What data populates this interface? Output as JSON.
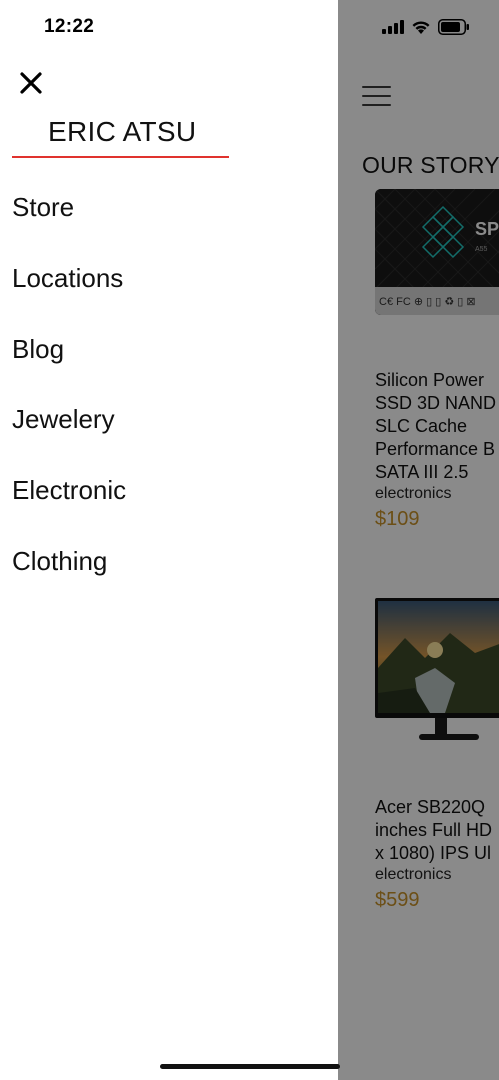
{
  "status_bar": {
    "time": "12:22"
  },
  "drawer": {
    "user_name": "ERIC ATSU",
    "menu_items": [
      {
        "label": "Store"
      },
      {
        "label": "Locations"
      },
      {
        "label": "Blog"
      },
      {
        "label": "Jewelery"
      },
      {
        "label": "Electronic"
      },
      {
        "label": "Clothing"
      }
    ],
    "accent_color": "#e0322e"
  },
  "background": {
    "section_title": "OUR STORY",
    "price_color": "#c8922a",
    "products": [
      {
        "name": "Silicon Power\nSSD 3D NAND\nSLC Cache\nPerformance B\nSATA III 2.5",
        "category": "electronics",
        "price": "$109"
      },
      {
        "name": "Acer SB220Q\ninches Full HD\nx 1080) IPS Ul",
        "category": "electronics",
        "price": "$599"
      }
    ]
  }
}
